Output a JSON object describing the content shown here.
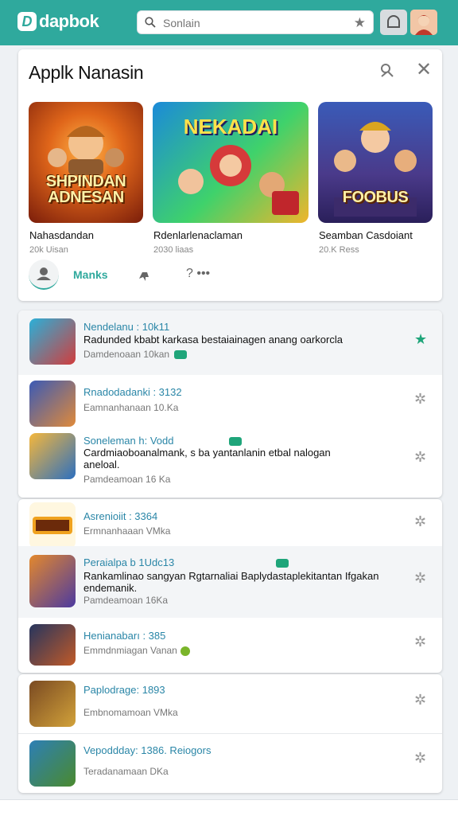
{
  "brand": {
    "logo_letter": "D",
    "name": "dapbok"
  },
  "search": {
    "placeholder": "Sonlain"
  },
  "featured": {
    "title": "Applk Nanasin",
    "items": [
      {
        "name": "Nahasdandan",
        "meta": "20k Uisan",
        "art_text": "SHPINDAN ADNESAN"
      },
      {
        "name": "Rdenlarlenaclaman",
        "meta": "2030 liaas",
        "art_text": "NEKADAI"
      },
      {
        "name": "Seamban Casdoiant",
        "meta": "20.K Ress",
        "art_text": "FOOBUS"
      }
    ],
    "actions": {
      "tab_label": "Manks",
      "more": "⁠? •••"
    }
  },
  "list_groups": [
    [
      {
        "title": "Nendelanu : 10k11",
        "desc": "Radunded kbabt karkasa bestaiainagen anang oarkorcla",
        "meta": "Damdenoaan 10kan",
        "badge": true,
        "fav": true,
        "highlight": true,
        "thumb": "a"
      },
      {
        "title": "Rnadodadanki : 3132",
        "desc": "",
        "meta": "Eamnanhanaan 10.Ka",
        "badge": false,
        "fav": false,
        "highlight": false,
        "thumb": "b"
      },
      {
        "title": "Soneleman h: Vodd",
        "desc": "Cardmiaoboanalmank, s ba yantanlanin etbal  nalogan aneloal.",
        "meta": "Pamdeamoan 16 Ka",
        "badge": true,
        "fav": false,
        "highlight": false,
        "thumb": "c"
      }
    ],
    [
      {
        "title": "Asrenioiit : 3364",
        "desc": "",
        "meta": "Ermnanhaaan VMka",
        "badge": false,
        "fav": false,
        "highlight": false,
        "thumb": "d"
      },
      {
        "title": "Peraialpa b 1Udc13",
        "desc": "Rankamlinao sangyan Rgtarnaliai Baplydastaplekitantan Ifgakan endemanik.",
        "meta": "Pamdeamoan 16Ka",
        "badge": true,
        "fav": false,
        "highlight": true,
        "thumb": "e"
      },
      {
        "title": "Henianabarı : 385",
        "desc": "",
        "meta": "Emmdnmiagan Vanan",
        "badge": false,
        "fav": false,
        "highlight": false,
        "thumb": "f"
      }
    ],
    [
      {
        "title": "Paplodrage: 1893",
        "desc": "",
        "meta": "Embnomamoan VMka",
        "badge": false,
        "fav": false,
        "highlight": false,
        "thumb": "g"
      },
      {
        "title": "Vepoddday: 1386. Reiogors",
        "desc": "",
        "meta": "Teradanamaan DKa",
        "badge": false,
        "fav": false,
        "highlight": false,
        "thumb": "h"
      }
    ]
  ],
  "colors": {
    "accent": "#2fa99d",
    "link": "#2a86a7",
    "fav_on": "#1fa57a"
  }
}
